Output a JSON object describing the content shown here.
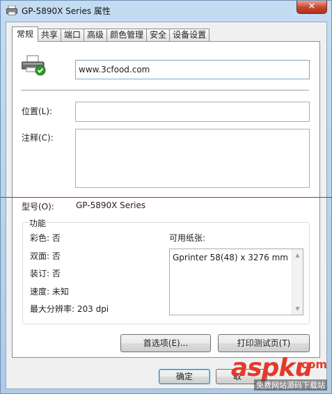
{
  "window": {
    "title": "GP-5890X Series 属性",
    "close_label": "✕"
  },
  "tabs": [
    {
      "label": "常规",
      "active": true
    },
    {
      "label": "共享"
    },
    {
      "label": "端口"
    },
    {
      "label": "高级"
    },
    {
      "label": "颜色管理"
    },
    {
      "label": "安全"
    },
    {
      "label": "设备设置"
    }
  ],
  "general": {
    "printer_name": "www.3cfood.com",
    "location_label": "位置(L):",
    "location_value": "",
    "comment_label": "注释(C):",
    "comment_value": "",
    "model_label": "型号(O):",
    "model_value": "GP-5890X Series"
  },
  "features": {
    "group_title": "功能",
    "color": "彩色: 否",
    "duplex": "双面: 否",
    "staple": "装订: 否",
    "speed": "速度: 未知",
    "max_resolution": "最大分辨率: 203 dpi",
    "paper_label": "可用纸张:",
    "paper_items": [
      "Gprinter 58(48) x 3276 mm"
    ]
  },
  "buttons": {
    "preferences": "首选项(E)...",
    "print_test": "打印测试页(T)",
    "ok": "确定",
    "cancel": "取"
  },
  "watermark": {
    "main_a": "asp",
    "main_b": "ku",
    "dot": ".com",
    "sub": "免费网站源码下载站"
  }
}
